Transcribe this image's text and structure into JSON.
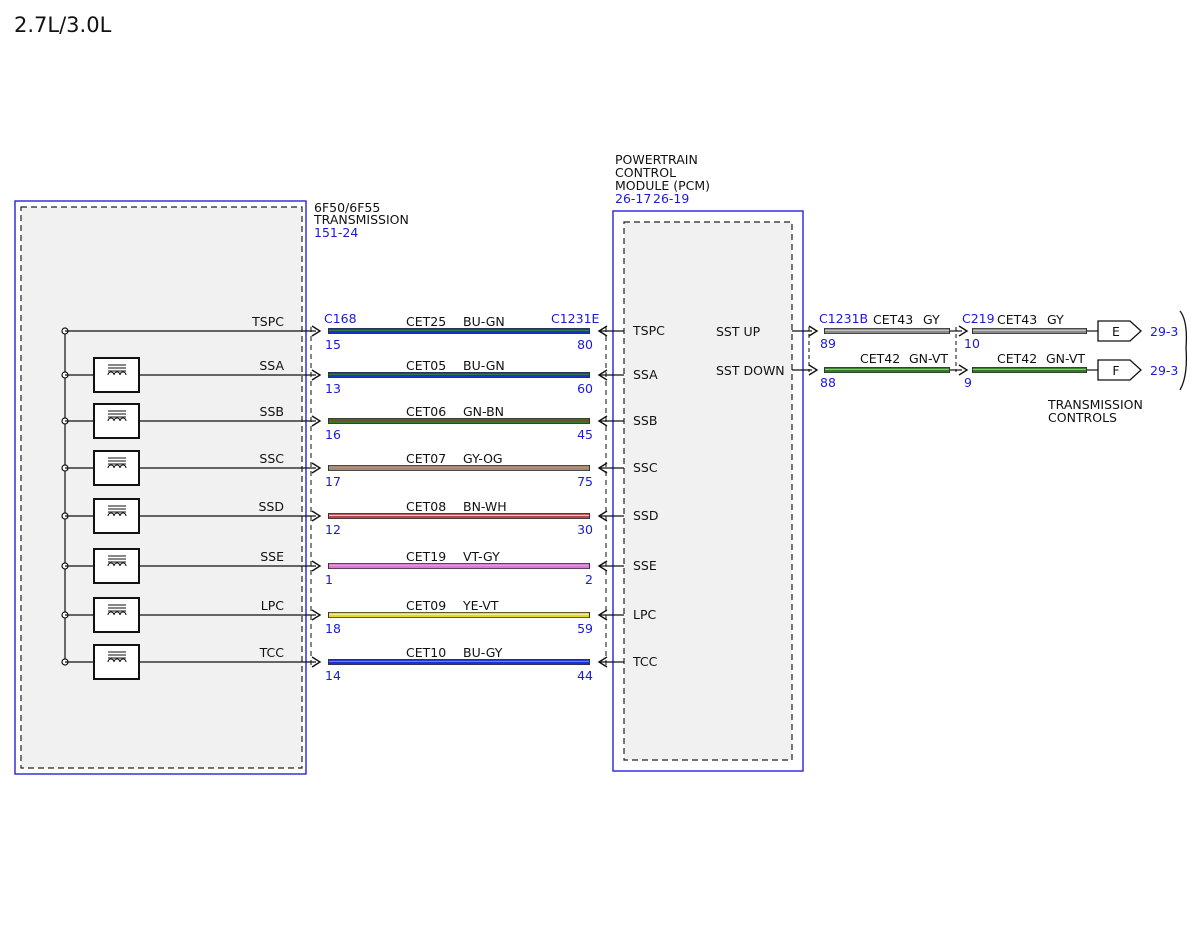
{
  "title": "2.7L/3.0L",
  "transmission": {
    "name_line1": "6F50/6F55",
    "name_line2": "TRANSMISSION",
    "ref": "151-24"
  },
  "pcm": {
    "name_line1": "POWERTRAIN",
    "name_line2": "CONTROL",
    "name_line3": "MODULE (PCM)",
    "ref1": "26-17",
    "ref2": "26-19",
    "out_labels": [
      "SST UP",
      "SST DOWN"
    ]
  },
  "connectors": {
    "left": "C168",
    "right": "C1231E",
    "out1": "C1231B",
    "out2": "C219"
  },
  "circuits": [
    {
      "signal": "TSPC",
      "circuit": "CET25",
      "color_code": "BU-GN",
      "pin_left": "15",
      "pin_right": "80",
      "color": "#1c2fd0",
      "stripe": "#2a8a3a",
      "solenoid": false
    },
    {
      "signal": "SSA",
      "circuit": "CET05",
      "color_code": "BU-GN",
      "pin_left": "13",
      "pin_right": "60",
      "color": "#1c2fd0",
      "stripe": "#2a8a3a",
      "solenoid": true
    },
    {
      "signal": "SSB",
      "circuit": "CET06",
      "color_code": "GN-BN",
      "pin_left": "16",
      "pin_right": "45",
      "color": "#2f7a22",
      "stripe": "#6b4a2a",
      "solenoid": true
    },
    {
      "signal": "SSC",
      "circuit": "CET07",
      "color_code": "GY-OG",
      "pin_left": "17",
      "pin_right": "75",
      "color": "#a08a78",
      "stripe": "#e08a30",
      "solenoid": true
    },
    {
      "signal": "SSD",
      "circuit": "CET08",
      "color_code": "BN-WH",
      "pin_left": "12",
      "pin_right": "30",
      "color": "#b24a4a",
      "stripe": "#f2d8d8",
      "solenoid": true
    },
    {
      "signal": "SSE",
      "circuit": "CET19",
      "color_code": "VT-GY",
      "pin_left": "1",
      "pin_right": "2",
      "color": "#d77ad0",
      "stripe": "#c8b0c8",
      "solenoid": true
    },
    {
      "signal": "LPC",
      "circuit": "CET09",
      "color_code": "YE-VT",
      "pin_left": "18",
      "pin_right": "59",
      "color": "#e8d81a",
      "stripe": "#f5f0a0",
      "solenoid": true
    },
    {
      "signal": "TCC",
      "circuit": "CET10",
      "color_code": "BU-GY",
      "pin_left": "14",
      "pin_right": "44",
      "color": "#1c2fd0",
      "stripe": "#8a8ad8",
      "solenoid": true
    }
  ],
  "outputs": [
    {
      "signal": "SST UP",
      "circuit": "CET43",
      "color_code": "GY",
      "pin_a": "89",
      "pin_b": "10",
      "arrow": "E",
      "ref": "29-3",
      "color": "#8a8a8a",
      "stripe": "#c8c8c8"
    },
    {
      "signal": "SST DOWN",
      "circuit": "CET42",
      "color_code": "GN-VT",
      "pin_a": "88",
      "pin_b": "9",
      "arrow": "F",
      "ref": "29-3",
      "color": "#2f7a22",
      "stripe": "#9ad08a"
    }
  ],
  "destination": {
    "line1": "TRANSMISSION",
    "line2": "CONTROLS"
  }
}
